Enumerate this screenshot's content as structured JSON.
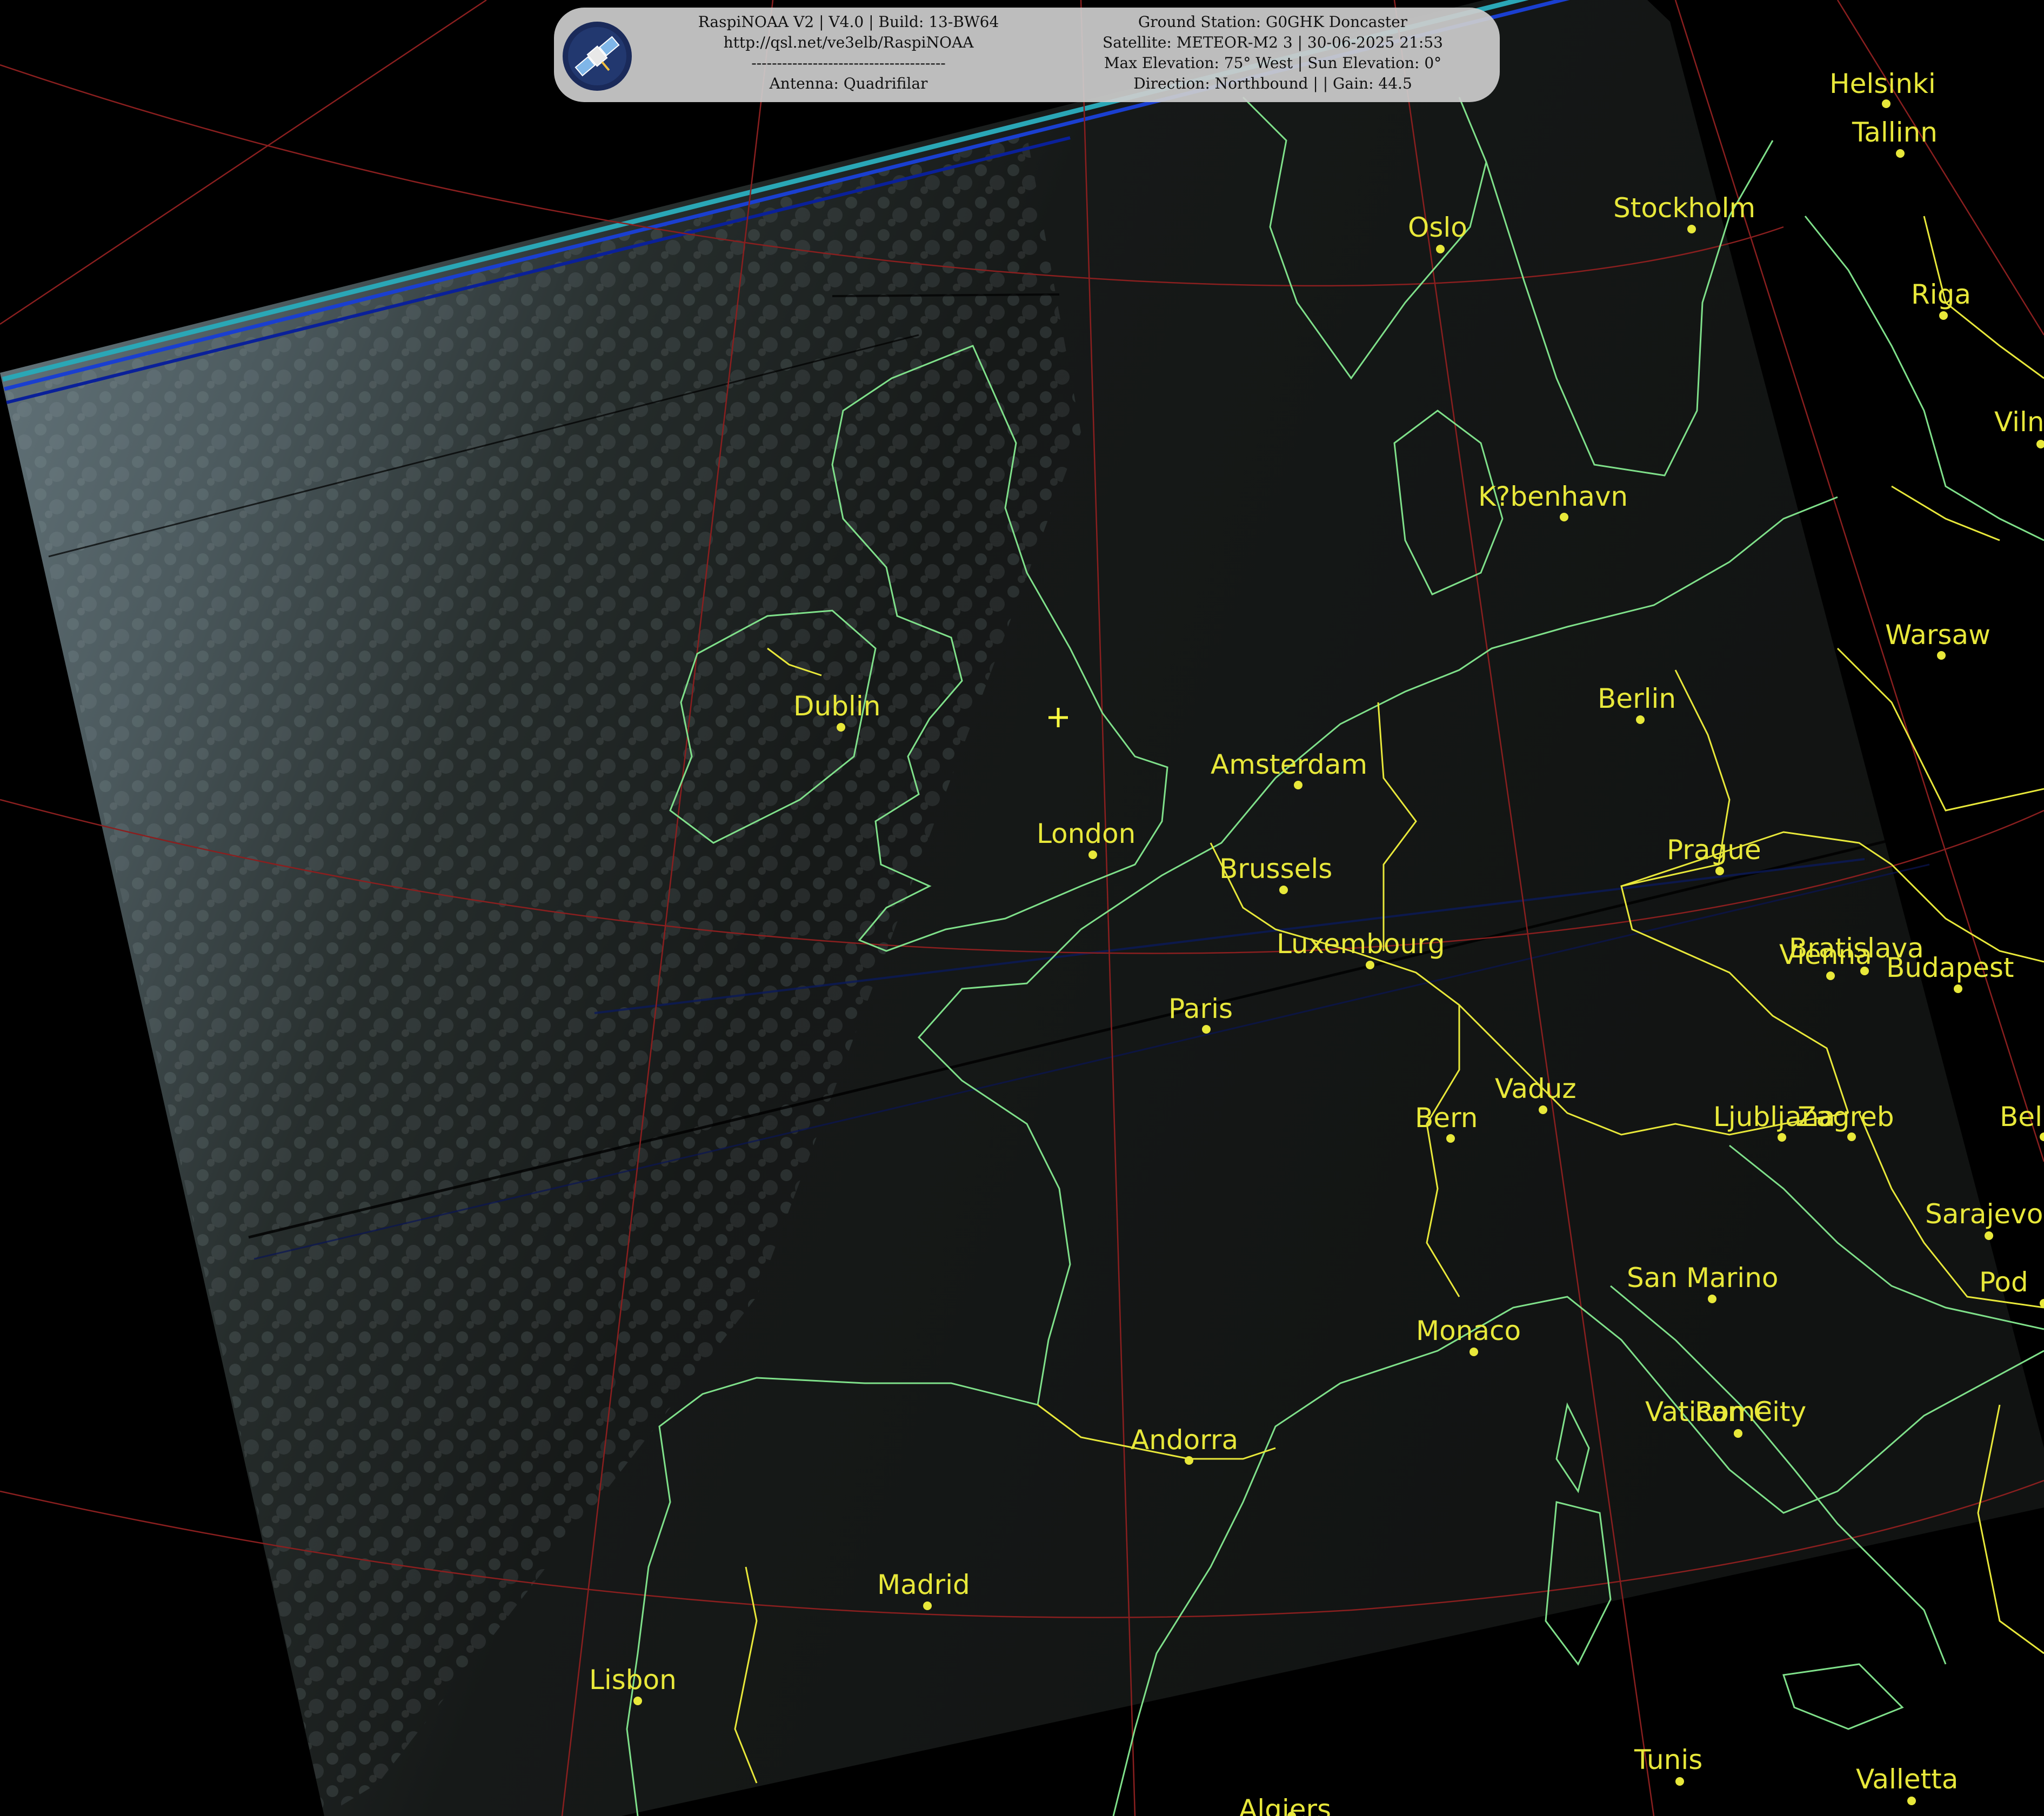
{
  "banner": {
    "left_lines": [
      "RaspiNOAA V2 | V4.0 | Build: 13-BW64",
      "http://qsl.net/ve3elb/RaspiNOAA",
      "--------------------------------------",
      "Antenna: Quadrifilar"
    ],
    "right_lines": [
      "Ground Station: G0GHK Doncaster",
      "Satellite: METEOR-M2 3 | 30-06-2025 21:53",
      "Max Elevation: 75° West | Sun Elevation: 0°",
      "Direction: Northbound | | Gain: 44.5"
    ]
  },
  "icons": [
    "satellite-logo-icon",
    "ground-station-cross-icon"
  ],
  "colors": {
    "city_label": "#e8e83a",
    "coastline": "#7fe08a",
    "border": "#e8e83a",
    "graticule": "#8a1f1f",
    "background": "#000000",
    "banner_background": "#cdcdcd"
  },
  "cities": [
    {
      "name": "Helsinki"
    },
    {
      "name": "Tallinn"
    },
    {
      "name": "Stockholm"
    },
    {
      "name": "Oslo"
    },
    {
      "name": "Riga"
    },
    {
      "name": "Viln"
    },
    {
      "name": "K?benhavn"
    },
    {
      "name": "Warsaw"
    },
    {
      "name": "Berlin"
    },
    {
      "name": "Dublin"
    },
    {
      "name": "Amsterdam"
    },
    {
      "name": "London"
    },
    {
      "name": "Brussels"
    },
    {
      "name": "Prague"
    },
    {
      "name": "Luxembourg"
    },
    {
      "name": "Bratislava"
    },
    {
      "name": "Vienna"
    },
    {
      "name": "Budapest"
    },
    {
      "name": "Paris"
    },
    {
      "name": "Vaduz"
    },
    {
      "name": "Bern"
    },
    {
      "name": "Ljubljana"
    },
    {
      "name": "Zagreb"
    },
    {
      "name": "Bel"
    },
    {
      "name": "Sarajevo"
    },
    {
      "name": "San Marino"
    },
    {
      "name": "Pod"
    },
    {
      "name": "Monaco"
    },
    {
      "name": "Vatican City"
    },
    {
      "name": "Rome"
    },
    {
      "name": "Andorra"
    },
    {
      "name": "Madrid"
    },
    {
      "name": "Lisbon"
    },
    {
      "name": "Tunis"
    },
    {
      "name": "Valletta"
    },
    {
      "name": "Algiers"
    }
  ]
}
